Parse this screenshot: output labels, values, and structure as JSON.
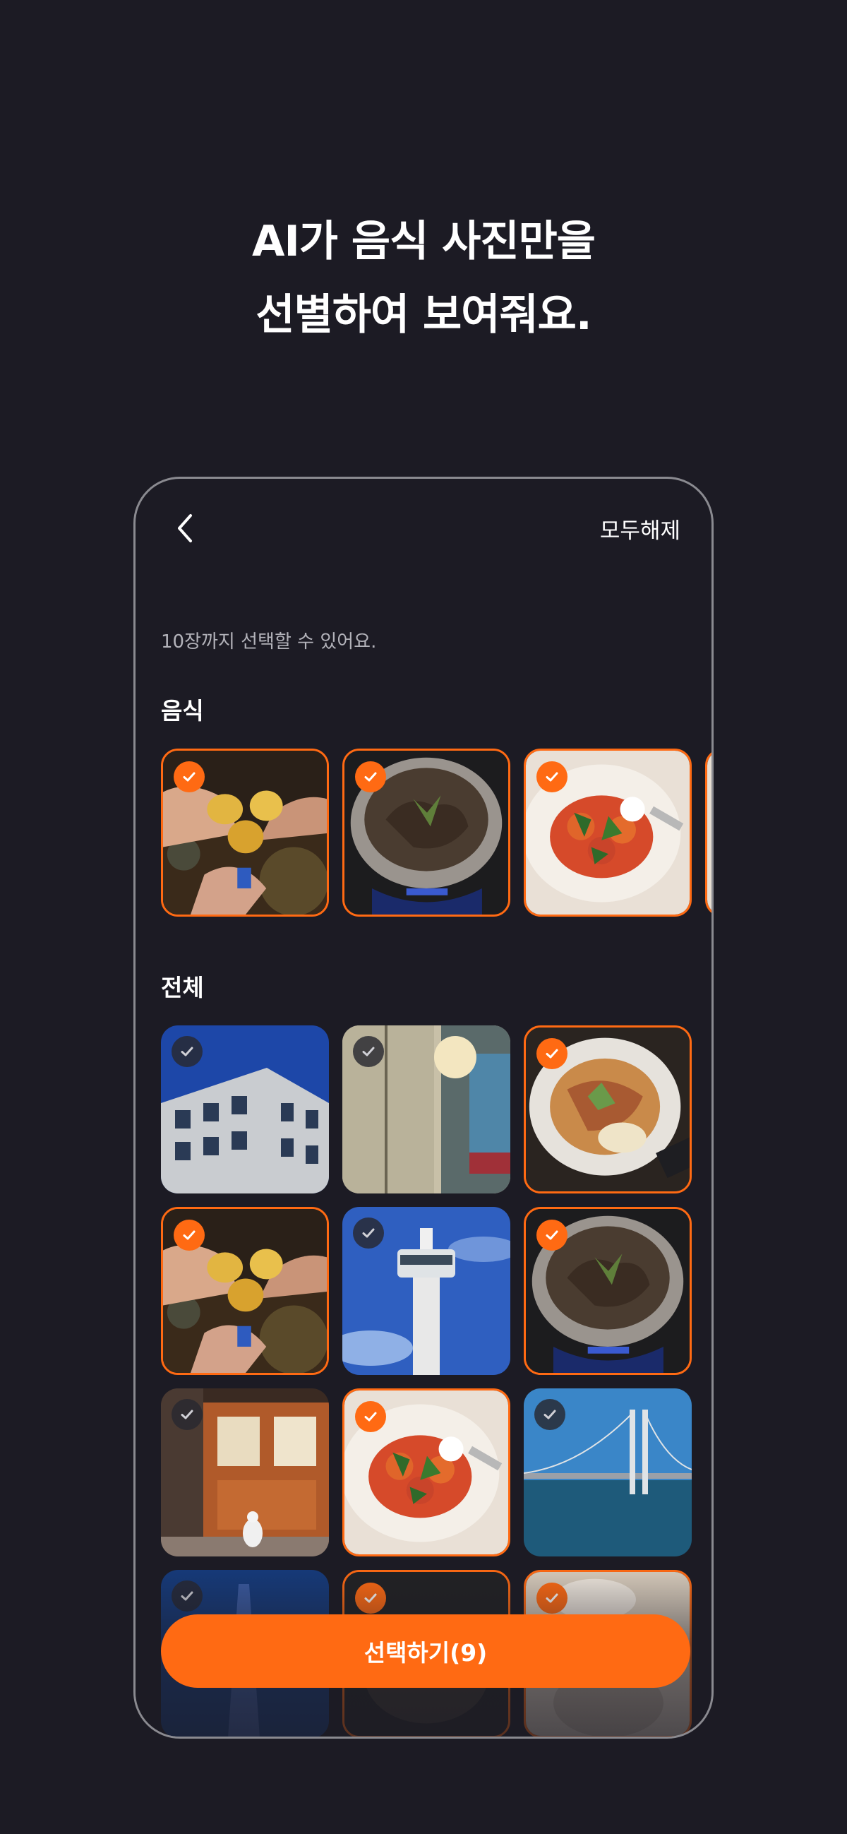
{
  "headline": {
    "line1": "AI가 음식 사진만을",
    "line2": "선별하여 보여줘요."
  },
  "header": {
    "back_icon": "chevron-left-icon",
    "deselect_all_label": "모두해제"
  },
  "hint_text": "10장까지 선택할 수 있어요.",
  "sections": {
    "food_title": "음식",
    "all_title": "전체"
  },
  "photos": {
    "food": [
      {
        "subject": "cocktail toast",
        "selected": true
      },
      {
        "subject": "grilled meat pan",
        "selected": true
      },
      {
        "subject": "caprese salad",
        "selected": true
      },
      {
        "subject": "partial photo",
        "selected": true
      }
    ],
    "all": [
      {
        "subject": "building",
        "selected": false
      },
      {
        "subject": "street wall",
        "selected": false
      },
      {
        "subject": "pasta",
        "selected": true
      },
      {
        "subject": "cocktail toast",
        "selected": true
      },
      {
        "subject": "control tower",
        "selected": false
      },
      {
        "subject": "grilled meat pan",
        "selected": true
      },
      {
        "subject": "duck by wooden door",
        "selected": false
      },
      {
        "subject": "caprese salad",
        "selected": true
      },
      {
        "subject": "suspension bridge",
        "selected": false
      },
      {
        "subject": "skyscraper",
        "selected": false
      },
      {
        "subject": "dining table",
        "selected": true
      },
      {
        "subject": "restaurant table",
        "selected": true
      }
    ]
  },
  "cta": {
    "label": "선택하기(9)"
  },
  "colors": {
    "accent": "#ff6a13",
    "background": "#1c1b24"
  }
}
